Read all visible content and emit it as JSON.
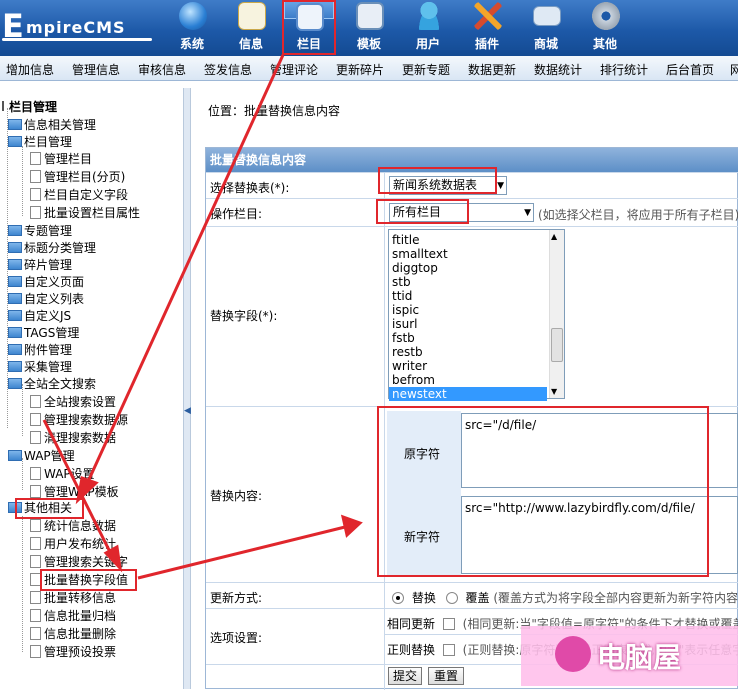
{
  "logo": {
    "initial": "E",
    "rest": "mpireCMS"
  },
  "topnav": [
    {
      "label": "系统",
      "icon": "globe-icon",
      "selected": false
    },
    {
      "label": "信息",
      "icon": "notepad-icon",
      "selected": false
    },
    {
      "label": "栏目",
      "icon": "window-icon",
      "selected": true
    },
    {
      "label": "模板",
      "icon": "template-icon",
      "selected": false
    },
    {
      "label": "用户",
      "icon": "user-icon",
      "selected": false
    },
    {
      "label": "插件",
      "icon": "tools-icon",
      "selected": false
    },
    {
      "label": "商城",
      "icon": "card-icon",
      "selected": false
    },
    {
      "label": "其他",
      "icon": "gear-icon",
      "selected": false
    }
  ],
  "menubar": [
    "增加信息",
    "管理信息",
    "审核信息",
    "签发信息",
    "管理评论",
    "更新碎片",
    "更新专题",
    "数据更新",
    "数据统计",
    "排行统计",
    "后台首页",
    "网"
  ],
  "tree": {
    "root": "栏目管理",
    "info_mgmt": "信息相关管理",
    "column_mgmt": "栏目管理",
    "manage_column": "管理栏目",
    "manage_column_paged": "管理栏目(分页)",
    "custom_fields": "栏目自定义字段",
    "batch_attr": "批量设置栏目属性",
    "topics": "专题管理",
    "title_cat": "标题分类管理",
    "fragments": "碎片管理",
    "custom_pages": "自定义页面",
    "custom_lists": "自定义列表",
    "custom_js": "自定义JS",
    "tags": "TAGS管理",
    "attachments": "附件管理",
    "collect": "采集管理",
    "fulltext": "全站全文搜索",
    "ft_settings": "全站搜索设置",
    "ft_manage": "管理搜索数据源",
    "ft_clean": "清理搜索数据",
    "wap": "WAP管理",
    "wap_settings": "WAP设置",
    "wap_templates": "管理WAP模板",
    "other": "其他相关",
    "stats": "统计信息数据",
    "user_stats": "用户发布统计",
    "search_keywords": "管理搜索关键字",
    "batch_replace": "批量替换字段值",
    "batch_move": "批量转移信息",
    "batch_archive": "信息批量归档",
    "batch_delete": "信息批量删除",
    "preset_votes": "管理预设投票"
  },
  "splitter_glyph": "◀",
  "breadcrumb": "位置：批量替换信息内容",
  "form": {
    "title": "批量替换信息内容",
    "table_label": "选择替换表(*):",
    "table_value": "新闻系统数据表",
    "column_label": "操作栏目:",
    "column_value": "所有栏目",
    "column_hint": "(如选择父栏目，将应用于所有子栏目)",
    "field_label": "替换字段(*):",
    "fields": [
      "ftitle",
      "smalltext",
      "diggtop",
      "stb",
      "ttid",
      "ispic",
      "isurl",
      "fstb",
      "restb",
      "writer",
      "befrom",
      "newstext"
    ],
    "selected_field": "newstext",
    "content_label": "替换内容:",
    "orig_label": "原字符",
    "orig_value": "src=\"/d/file/",
    "new_label": "新字符",
    "new_value": "src=\"http://www.lazybirdfly.com/d/file/",
    "mode_label": "更新方式:",
    "mode_replace": "替换",
    "mode_overwrite": "覆盖",
    "mode_hint": "(覆盖方式为将字段全部内容更新为新字符内容)",
    "options_label": "选项设置:",
    "opt1_label": "相同更新",
    "opt1_hint": "(相同更新:当\"字段值=原字符\"的条件下才替换或覆盖)",
    "opt2_label": "正则替换",
    "opt2_hint": "(正则替换:原字符可以是正则表达式,用\"*\"表示任意字符)",
    "submit": "提交",
    "reset": "重置"
  },
  "watermark": {
    "text": "电脑屋"
  },
  "colors": {
    "annotation": "#e0262c",
    "header": "#1d59a8",
    "selection": "#3399ff"
  }
}
